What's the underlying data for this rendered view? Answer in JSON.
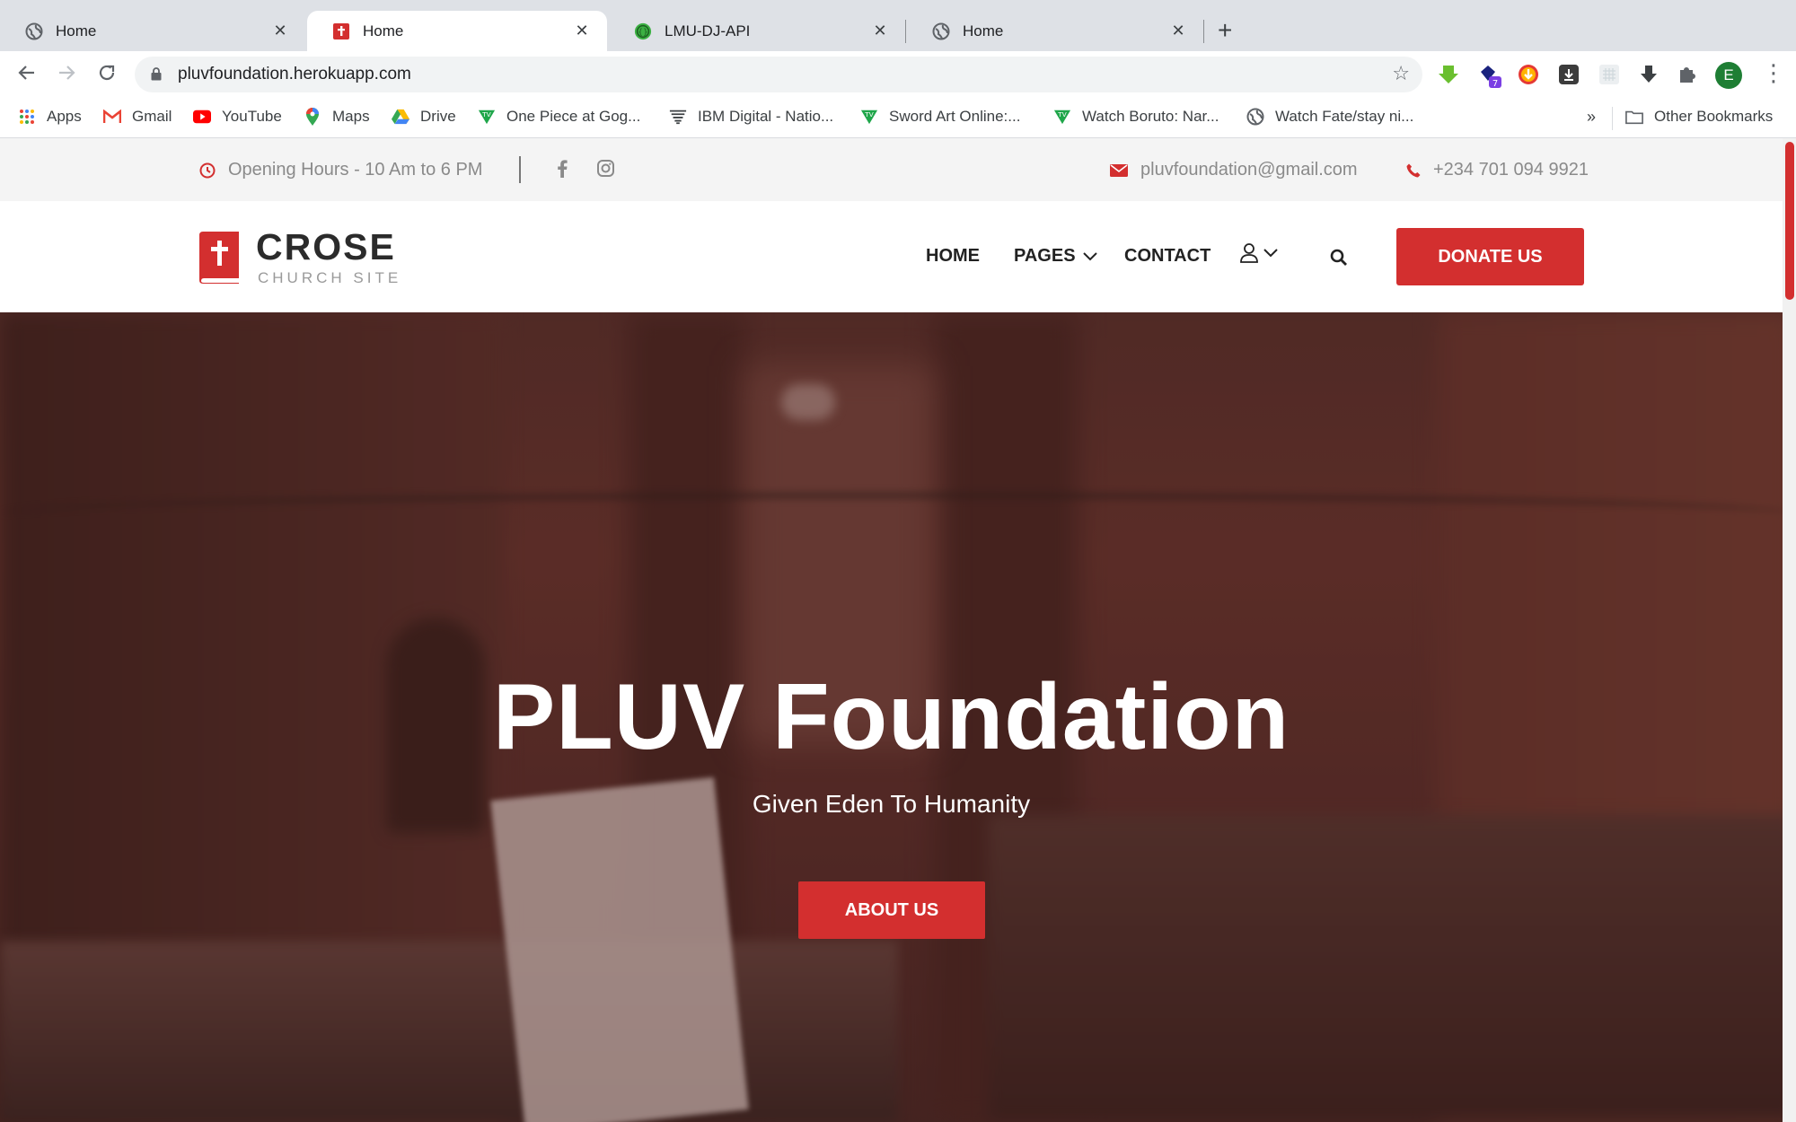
{
  "browser": {
    "tabs": [
      {
        "title": "Home",
        "icon": "globe-icon",
        "active": false
      },
      {
        "title": "Home",
        "icon": "crose-favicon",
        "active": true
      },
      {
        "title": "LMU-DJ-API",
        "icon": "api-favicon",
        "active": false
      },
      {
        "title": "Home",
        "icon": "globe-icon",
        "active": false
      }
    ],
    "new_tab": "+",
    "close_glyph": "✕",
    "url": "pluvfoundation.herokuapp.com",
    "profile_initial": "E",
    "extension_badge": "7",
    "bookmarks": [
      {
        "label": "Apps",
        "icon": "apps-grid-icon"
      },
      {
        "label": "Gmail",
        "icon": "gmail-icon"
      },
      {
        "label": "YouTube",
        "icon": "youtube-icon"
      },
      {
        "label": "Maps",
        "icon": "maps-pin-icon"
      },
      {
        "label": "Drive",
        "icon": "drive-icon"
      },
      {
        "label": "One Piece at Gog...",
        "icon": "tv-shield-icon"
      },
      {
        "label": "IBM Digital - Natio...",
        "icon": "ibm-icon"
      },
      {
        "label": "Sword Art Online:...",
        "icon": "tv-shield-icon"
      },
      {
        "label": "Watch Boruto: Nar...",
        "icon": "tv-shield-icon"
      },
      {
        "label": "Watch Fate/stay ni...",
        "icon": "globe-icon"
      }
    ],
    "overflow": "»",
    "other_bookmarks": "Other Bookmarks"
  },
  "topbar": {
    "hours": "Opening Hours - 10 Am to 6 PM",
    "email": "pluvfoundation@gmail.com",
    "phone": "+234 701 094 9921"
  },
  "header": {
    "logo_title": "CROSE",
    "logo_subtitle": "CHURCH SITE",
    "nav": {
      "home": "HOME",
      "pages": "PAGES",
      "contact": "CONTACT"
    },
    "donate": "DONATE US"
  },
  "hero": {
    "title": "PLUV Foundation",
    "subtitle": "Given Eden To Humanity",
    "cta": "ABOUT US"
  },
  "colors": {
    "accent": "#d32f2f",
    "topbar_bg": "#f4f4f4",
    "tab_strip": "#dee1e6"
  }
}
